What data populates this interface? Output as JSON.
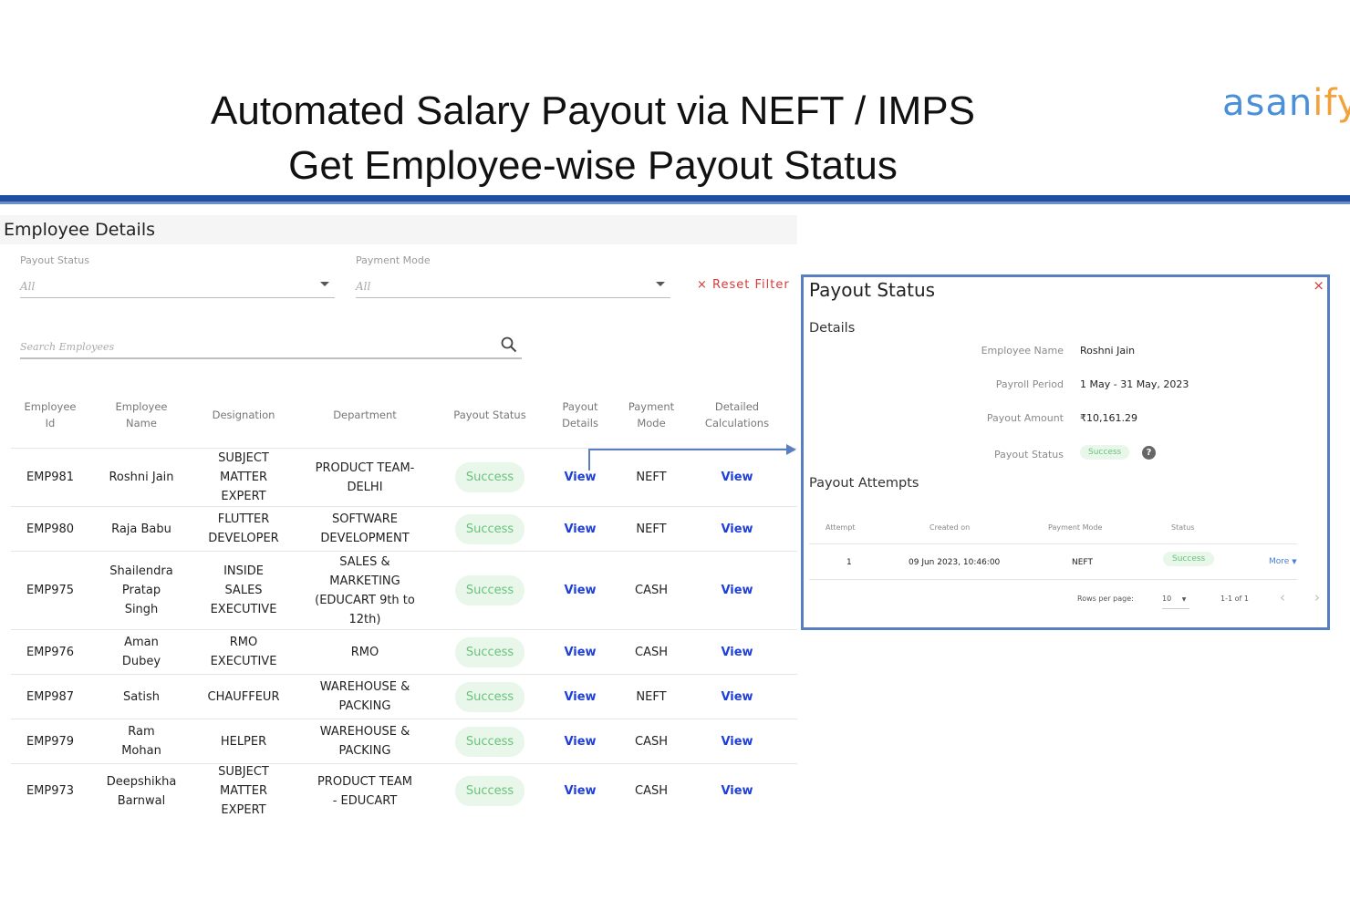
{
  "slide": {
    "title_line1": "Automated Salary Payout via NEFT / IMPS",
    "title_line2": "Get Employee-wise Payout Status",
    "logo_part1": "asan",
    "logo_part2": "ify"
  },
  "panel": {
    "heading": "Employee Details",
    "filters": {
      "payout_status_label": "Payout Status",
      "payout_status_value": "All",
      "payment_mode_label": "Payment Mode",
      "payment_mode_value": "All",
      "reset_label": "Reset Filter",
      "reset_icon": "×"
    },
    "search": {
      "placeholder": "Search Employees"
    },
    "columns": [
      "Employee\nId",
      "Employee\nName",
      "Designation",
      "Department",
      "Payout Status",
      "Payout\nDetails",
      "Payment\nMode",
      "Detailed\nCalculations"
    ],
    "rows": [
      {
        "id": "EMP981",
        "name": "Roshni Jain",
        "designation": "SUBJECT\nMATTER\nEXPERT",
        "department": "PRODUCT TEAM-\nDELHI",
        "status": "Success",
        "details": "View",
        "mode": "NEFT",
        "calc": "View"
      },
      {
        "id": "EMP980",
        "name": "Raja Babu",
        "designation": "FLUTTER\nDEVELOPER",
        "department": "SOFTWARE\nDEVELOPMENT",
        "status": "Success",
        "details": "View",
        "mode": "NEFT",
        "calc": "View"
      },
      {
        "id": "EMP975",
        "name": "Shailendra\nPratap\nSingh",
        "designation": "INSIDE\nSALES\nEXECUTIVE",
        "department": "SALES &\nMARKETING\n(EDUCART 9th to\n12th)",
        "status": "Success",
        "details": "View",
        "mode": "CASH",
        "calc": "View"
      },
      {
        "id": "EMP976",
        "name": "Aman\nDubey",
        "designation": "RMO\nEXECUTIVE",
        "department": "RMO",
        "status": "Success",
        "details": "View",
        "mode": "CASH",
        "calc": "View"
      },
      {
        "id": "EMP987",
        "name": "Satish",
        "designation": "CHAUFFEUR",
        "department": "WAREHOUSE &\nPACKING",
        "status": "Success",
        "details": "View",
        "mode": "NEFT",
        "calc": "View"
      },
      {
        "id": "EMP979",
        "name": "Ram\nMohan",
        "designation": "HELPER",
        "department": "WAREHOUSE &\nPACKING",
        "status": "Success",
        "details": "View",
        "mode": "CASH",
        "calc": "View"
      },
      {
        "id": "EMP973",
        "name": "Deepshikha\nBarnwal",
        "designation": "SUBJECT\nMATTER\nEXPERT",
        "department": "PRODUCT TEAM\n- EDUCART",
        "status": "Success",
        "details": "View",
        "mode": "CASH",
        "calc": "View"
      }
    ]
  },
  "modal": {
    "title": "Payout Status",
    "close_icon": "×",
    "details_heading": "Details",
    "details": [
      {
        "key": "Employee Name",
        "value": "Roshni Jain"
      },
      {
        "key": "Payroll Period",
        "value": "1 May - 31 May, 2023"
      },
      {
        "key": "Payout Amount",
        "value": "₹10,161.29"
      },
      {
        "key": "Payout Status",
        "value": "Success"
      }
    ],
    "help_icon": "?",
    "attempts_heading": "Payout Attempts",
    "attempt_columns": [
      "Attempt",
      "Created on",
      "Payment Mode",
      "Status"
    ],
    "attempts": [
      {
        "attempt": "1",
        "created_on": "09 Jun 2023, 10:46:00",
        "mode": "NEFT",
        "status": "Success",
        "action": "More"
      }
    ],
    "pagination": {
      "rows_per_page_label": "Rows per page:",
      "rows_per_page": "10",
      "range": "1-1 of 1",
      "prev_icon": "‹",
      "next_icon": "›"
    }
  },
  "colors": {
    "accent_blue": "#1f4fa3",
    "success_green": "#67c37a",
    "link_blue": "#1f3fd9",
    "reset_red": "#d63a3a"
  }
}
